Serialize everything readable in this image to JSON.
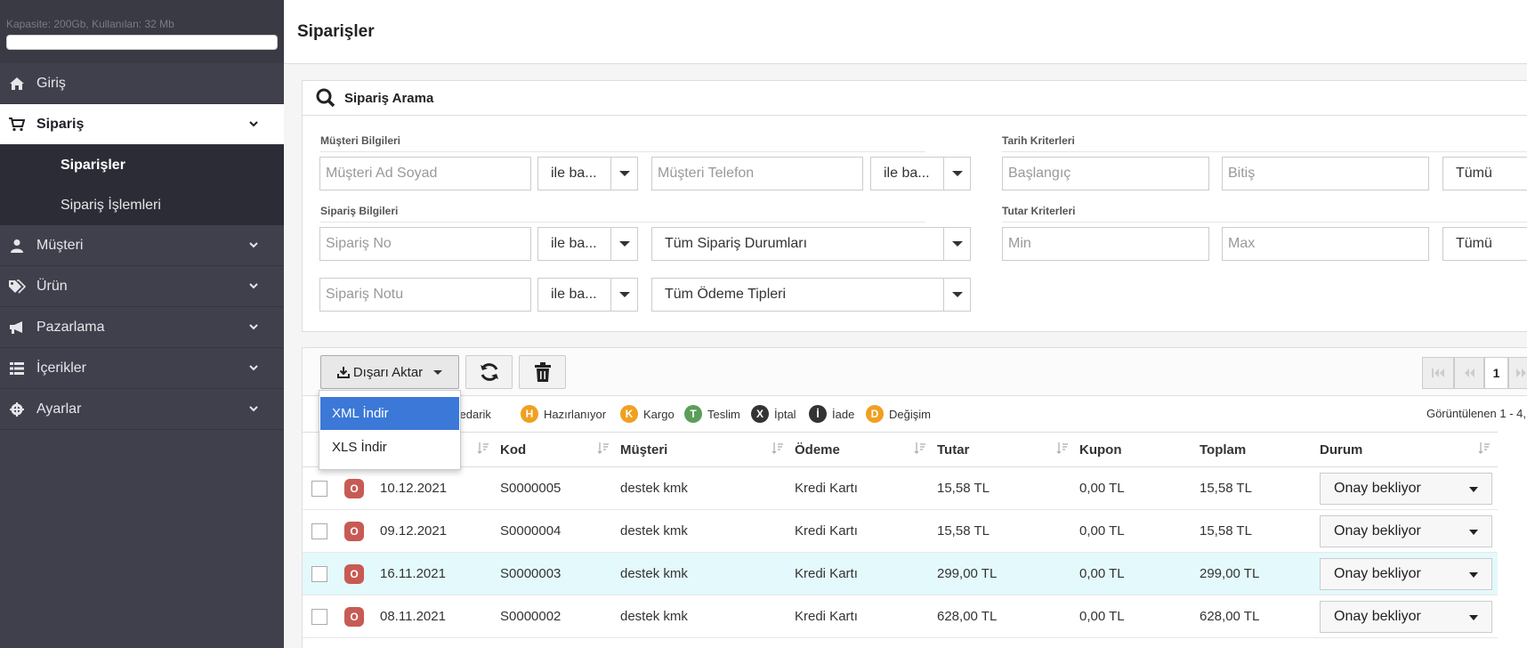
{
  "sidebar": {
    "quota_text": "Kapasite: 200Gb, Kullanılan: 32 Mb",
    "items": [
      {
        "label": "Giriş",
        "icon": "home-icon"
      },
      {
        "label": "Sipariş",
        "icon": "cart-icon"
      },
      {
        "label": "Müşteri",
        "icon": "user-icon"
      },
      {
        "label": "Ürün",
        "icon": "tags-icon"
      },
      {
        "label": "Pazarlama",
        "icon": "megaphone-icon"
      },
      {
        "label": "İçerikler",
        "icon": "list-icon"
      },
      {
        "label": "Ayarlar",
        "icon": "gear-icon"
      }
    ],
    "subitems": [
      {
        "label": "Siparişler"
      },
      {
        "label": "Sipariş İşlemleri"
      }
    ]
  },
  "header": {
    "title": "Siparişler"
  },
  "search": {
    "title": "Sipariş Arama",
    "customer_section": "Müşteri Bilgileri",
    "order_section": "Sipariş Bilgileri",
    "date_section": "Tarih Kriterleri",
    "amount_section": "Tutar Kriterleri",
    "customer_name_placeholder": "Müşteri Ad Soyad",
    "customer_phone_placeholder": "Müşteri Telefon",
    "order_no_placeholder": "Sipariş No",
    "order_note_placeholder": "Sipariş Notu",
    "start_placeholder": "Başlangıç",
    "end_placeholder": "Bitiş",
    "min_placeholder": "Min",
    "max_placeholder": "Max",
    "match_option": "ile ba...",
    "order_status_option": "Tüm Sipariş Durumları",
    "payment_type_option": "Tüm Ödeme Tipleri",
    "all_option": "Tümü"
  },
  "toolbar": {
    "export_label": "Dışarı Aktar",
    "page_number": "1"
  },
  "export_menu": {
    "items": [
      "XML İndir",
      "XLS İndir"
    ]
  },
  "legend": {
    "items": [
      {
        "letter": "",
        "label": "Tedarik",
        "color": "#4a8ad0"
      },
      {
        "letter": "H",
        "label": "Hazırlanıyor",
        "color": "#f0a020"
      },
      {
        "letter": "K",
        "label": "Kargo",
        "color": "#f0a020"
      },
      {
        "letter": "T",
        "label": "Teslim",
        "color": "#5a9e5a"
      },
      {
        "letter": "X",
        "label": "İptal",
        "color": "#333333"
      },
      {
        "letter": "İ",
        "label": "İade",
        "color": "#333333"
      },
      {
        "letter": "D",
        "label": "Değişim",
        "color": "#f0a020"
      }
    ],
    "showing_text": "Görüntülenen 1 - 4,"
  },
  "table": {
    "headers": [
      "Kod",
      "Müşteri",
      "Ödeme",
      "Tutar",
      "Kupon",
      "Toplam",
      "Durum"
    ],
    "rows": [
      {
        "status_letter": "O",
        "date": "10.12.2021",
        "code": "S0000005",
        "customer": "destek kmk",
        "payment": "Kredi Kartı",
        "amount": "15,58 TL",
        "coupon": "0,00 TL",
        "total": "15,58 TL",
        "status": "Onay bekliyor"
      },
      {
        "status_letter": "O",
        "date": "09.12.2021",
        "code": "S0000004",
        "customer": "destek kmk",
        "payment": "Kredi Kartı",
        "amount": "15,58 TL",
        "coupon": "0,00 TL",
        "total": "15,58 TL",
        "status": "Onay bekliyor"
      },
      {
        "status_letter": "O",
        "date": "16.11.2021",
        "code": "S0000003",
        "customer": "destek kmk",
        "payment": "Kredi Kartı",
        "amount": "299,00 TL",
        "coupon": "0,00 TL",
        "total": "299,00 TL",
        "status": "Onay bekliyor"
      },
      {
        "status_letter": "O",
        "date": "08.11.2021",
        "code": "S0000002",
        "customer": "destek kmk",
        "payment": "Kredi Kartı",
        "amount": "628,00 TL",
        "coupon": "0,00 TL",
        "total": "628,00 TL",
        "status": "Onay bekliyor"
      }
    ]
  }
}
